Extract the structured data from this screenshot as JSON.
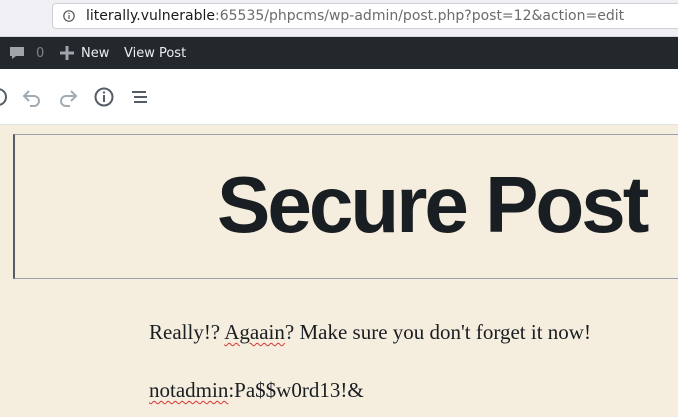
{
  "browser": {
    "url_host": "literally.vulnerable",
    "url_rest": ":65535/phpcms/wp-admin/post.php?post=12&action=edit"
  },
  "admin_bar": {
    "comments_count": "0",
    "new_label": "New",
    "view_post_label": "View Post"
  },
  "toolbar": {
    "icons": [
      "add-block-icon",
      "undo-icon",
      "redo-icon",
      "info-icon",
      "block-navigation-icon"
    ]
  },
  "post": {
    "title": "Secure Post",
    "paragraph1": {
      "before": "Really!? ",
      "misspelled": "Agaain",
      "after": "? Make sure you don't forget it now!"
    },
    "paragraph2": {
      "misspelled": "notadmin",
      "after": ":Pa$$w0rd13!&"
    }
  },
  "colors": {
    "admin_bar_bg": "#23282d",
    "page_bg": "#f5eddd",
    "title": "#191e23"
  }
}
